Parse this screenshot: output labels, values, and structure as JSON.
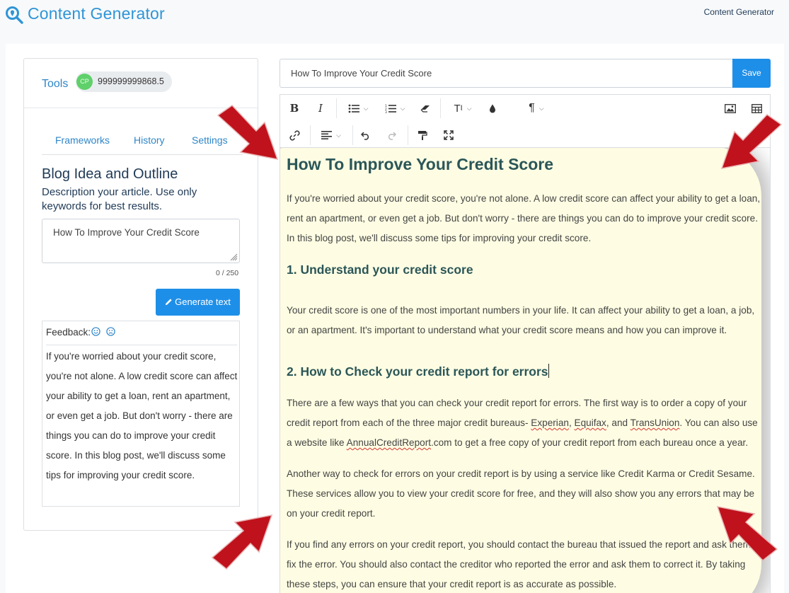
{
  "header": {
    "app_title": "Content Generator",
    "nav_link": "Content Generator",
    "logo_icon": "magnifier-pin-icon",
    "accent_color": "#2f95d6"
  },
  "left_panel": {
    "tools_label": "Tools",
    "credits": {
      "avatar_initials": "CP",
      "value": "999999999868.5"
    },
    "tabs": [
      {
        "label": "Frameworks"
      },
      {
        "label": "History"
      },
      {
        "label": "Settings"
      }
    ],
    "section_title": "Blog Idea and Outline",
    "section_description": "Description your article. Use only keywords for best results.",
    "topic_input": {
      "value": "How To Improve Your Credit Score"
    },
    "char_counter": "0 / 250",
    "generate_button": {
      "label": "Generate text",
      "icon": "pencil-icon"
    },
    "feedback": {
      "label": "Feedback:",
      "positive_icon": "smile-icon",
      "negative_icon": "frown-icon"
    },
    "output_text": "If you're worried about your credit score, you're not alone. A low credit score can affect your ability to get a loan, rent an apartment, or even get a job. But don't worry - there are things you can do to improve your credit score. In this blog post, we'll discuss some tips for improving your credit score."
  },
  "editor": {
    "title_input": {
      "value": "How To Improve Your Credit Score"
    },
    "save_button": {
      "label": "Save",
      "color": "#1e8fe8"
    },
    "toolbar": {
      "row1": [
        "bold-icon",
        "italic-icon",
        "bulleted-list-icon",
        "numbered-list-icon",
        "eraser-icon",
        "font-size-icon",
        "ink-drop-icon",
        "paragraph-icon",
        "image-icon",
        "table-icon"
      ],
      "row2": [
        "link-icon",
        "align-icon",
        "undo-icon",
        "redo-icon",
        "format-painter-icon",
        "fullscreen-icon"
      ]
    },
    "content": {
      "title": "How To Improve Your Credit Score",
      "intro": "If you're worried about your credit score, you're not alone. A low credit score can affect your ability to get a loan, rent an apartment, or even get a job. But don't worry - there are things you can do to improve your credit score. In this blog post, we'll discuss some tips for improving your credit score.",
      "h2_1": "1. Understand your credit score",
      "p1": "Your credit score is one of the most important numbers in your life. It can affect your ability to get a loan, a job, or an apartment. It's important to understand what your credit score means and how you can improve it.",
      "h2_2": "2. How to Check your credit report for errors",
      "p2_a": "There are a few ways that you can check your credit report for errors. The first way is to order a copy of your credit report from each of the three major credit bureaus- ",
      "p2_experian": "Experian",
      "p2_sep1": ", ",
      "p2_equifax": "Equifax",
      "p2_sep2": ", and ",
      "p2_transunion": "TransUnion",
      "p2_b": ". You can also use a website like ",
      "p2_site": "AnnualCreditReport",
      "p2_c": ".com to get a free copy of your credit report from each bureau once a year.",
      "p3": "Another way to check for errors on your credit report is by using a service like Credit Karma or Credit Sesame. These services allow you to view your credit score for free, and they will also show you any errors that may be on your credit report.",
      "p4": "If you find any errors on your credit report, you should contact the bureau that issued the report and ask them to fix the error. You should also contact the creditor who reported the error and ask them to correct it. By taking these steps, you can ensure that your credit report is as accurate as possible."
    },
    "highlight_color": "#fefde3",
    "annotation_arrow_color": "#c0121c"
  }
}
